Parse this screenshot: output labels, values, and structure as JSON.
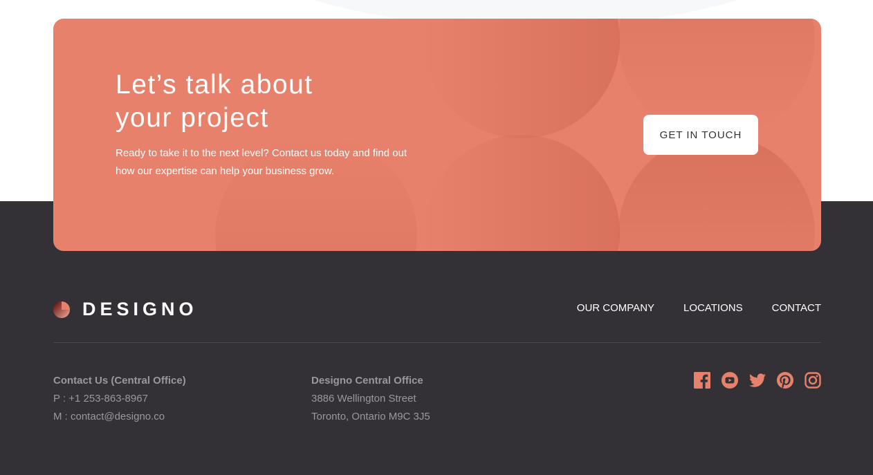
{
  "cta": {
    "title_line1": "Let’s talk about",
    "title_line2": "your project",
    "text": "Ready to take it to the next level? Contact us today and find out how our expertise can help your business grow.",
    "button_label": "GET IN TOUCH"
  },
  "footer": {
    "logo_text": "DESIGNO",
    "nav": [
      "OUR COMPANY",
      "LOCATIONS",
      "CONTACT"
    ],
    "contact": {
      "heading": "Contact Us (Central Office)",
      "phone": "P : +1 253-863-8967",
      "email": "M : contact@designo.co"
    },
    "office": {
      "heading": "Designo Central Office",
      "street": "3886 Wellington Street",
      "city": "Toronto, Ontario M9C 3J5"
    },
    "social_icons": [
      "facebook-icon",
      "youtube-icon",
      "twitter-icon",
      "pinterest-icon",
      "instagram-icon"
    ]
  },
  "colors": {
    "peach": "#e7816b",
    "dark": "#333136",
    "white": "#ffffff",
    "muted_text": "#9a989c"
  }
}
